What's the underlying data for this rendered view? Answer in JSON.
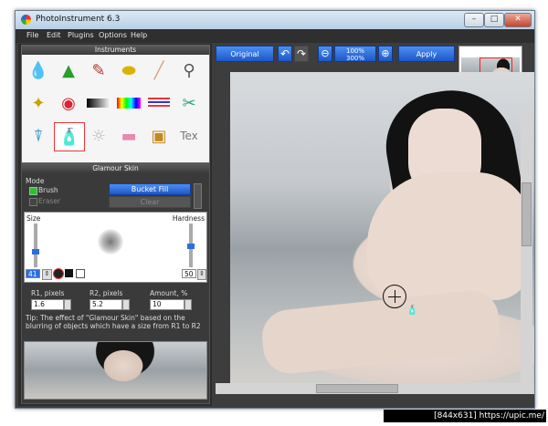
{
  "window": {
    "title": "PhotoInstrument 6.3"
  },
  "menu": [
    "File",
    "Edit",
    "Plugins",
    "Options",
    "Help"
  ],
  "instruments_panel": {
    "title": "Instruments"
  },
  "glamour_panel": {
    "title": "Glamour Skin",
    "mode_label": "Mode",
    "brush_label": "Brush",
    "eraser_label": "Eraser",
    "bucket_fill_label": "Bucket Fill",
    "clear_label": "Clear",
    "size_label": "Size",
    "hardness_label": "Hardness",
    "size_value": "41",
    "hardness_value": "50",
    "r1_label": "R1, pixels",
    "r1_value": "1.6",
    "r2_label": "R2, pixels",
    "r2_value": "5.2",
    "amount_label": "Amount, %",
    "amount_value": "10",
    "tip": "Tip: The effect of \"Glamour Skin\" based on the blurring of objects which have a size from R1 to R2"
  },
  "toolbar": {
    "original_label": "Original",
    "zoom_100": "100%",
    "zoom_300": "300%",
    "apply_label": "Apply"
  },
  "watermark": "[844x631] https://upic.me/",
  "colors": {
    "accent_blue": "#2b6fe0",
    "panel_bg": "#2c2c2c",
    "window_frame": "#3d3d3d"
  }
}
